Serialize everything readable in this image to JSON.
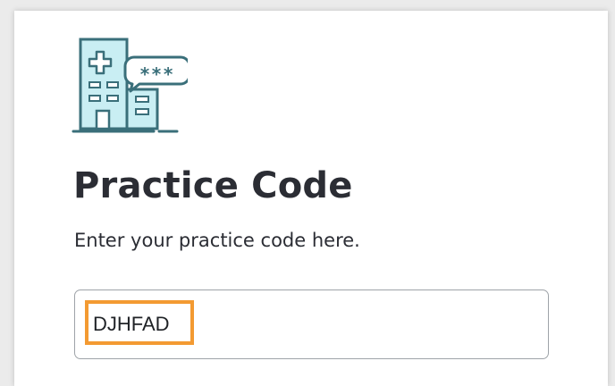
{
  "page": {
    "title": "Practice Code",
    "subtitle": "Enter your practice code here."
  },
  "code_input": {
    "value": "DJHFAD",
    "placeholder": ""
  },
  "illustration": {
    "icon": "hospital-building-icon",
    "badge_icon": "speech-bubble-icon",
    "badge_text": "***"
  },
  "colors": {
    "icon_stroke": "#3a6f7a",
    "icon_fill": "#c9eef3",
    "title_text": "#2b2d34",
    "input_border": "#9ea3a8",
    "highlight": "#f39a32"
  }
}
